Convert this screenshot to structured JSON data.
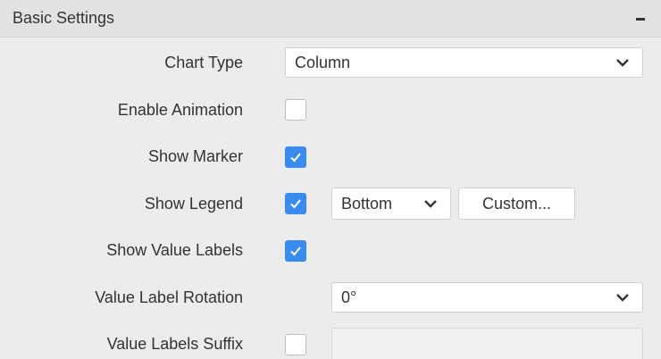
{
  "header": {
    "title": "Basic Settings",
    "collapse_icon": "minus-icon"
  },
  "settings": {
    "chart_type": {
      "label": "Chart Type",
      "value": "Column",
      "icon": "chevron-down-icon"
    },
    "enable_animation": {
      "label": "Enable Animation",
      "checked": false
    },
    "show_marker": {
      "label": "Show Marker",
      "checked": true
    },
    "show_legend": {
      "label": "Show Legend",
      "checked": true,
      "position_value": "Bottom",
      "custom_button_label": "Custom..."
    },
    "show_value_labels": {
      "label": "Show Value Labels",
      "checked": true
    },
    "value_label_rotation": {
      "label": "Value Label Rotation",
      "value": "0°"
    },
    "value_labels_suffix": {
      "label": "Value Labels Suffix",
      "checked": false,
      "value": ""
    }
  },
  "colors": {
    "accent": "#3a8bf0",
    "header_bg": "#e2e2e2",
    "panel_bg": "#ececec"
  }
}
